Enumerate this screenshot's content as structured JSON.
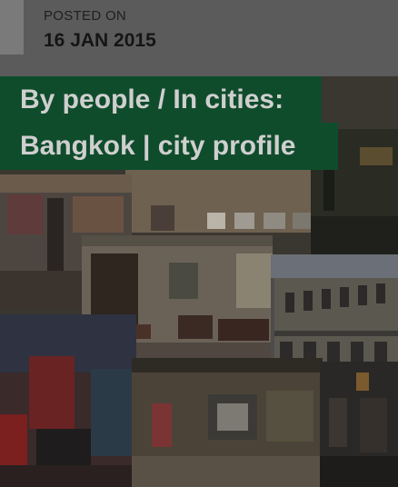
{
  "post": {
    "posted_label": "POSTED ON",
    "posted_date": "16 JAN 2015"
  },
  "title": {
    "line1": "By people / In cities:",
    "line2": "Bangkok | city profile"
  },
  "colors": {
    "title_background": "#0f4c2c",
    "title_text": "#cfcfcf",
    "overlay": "#4a4a4a"
  }
}
